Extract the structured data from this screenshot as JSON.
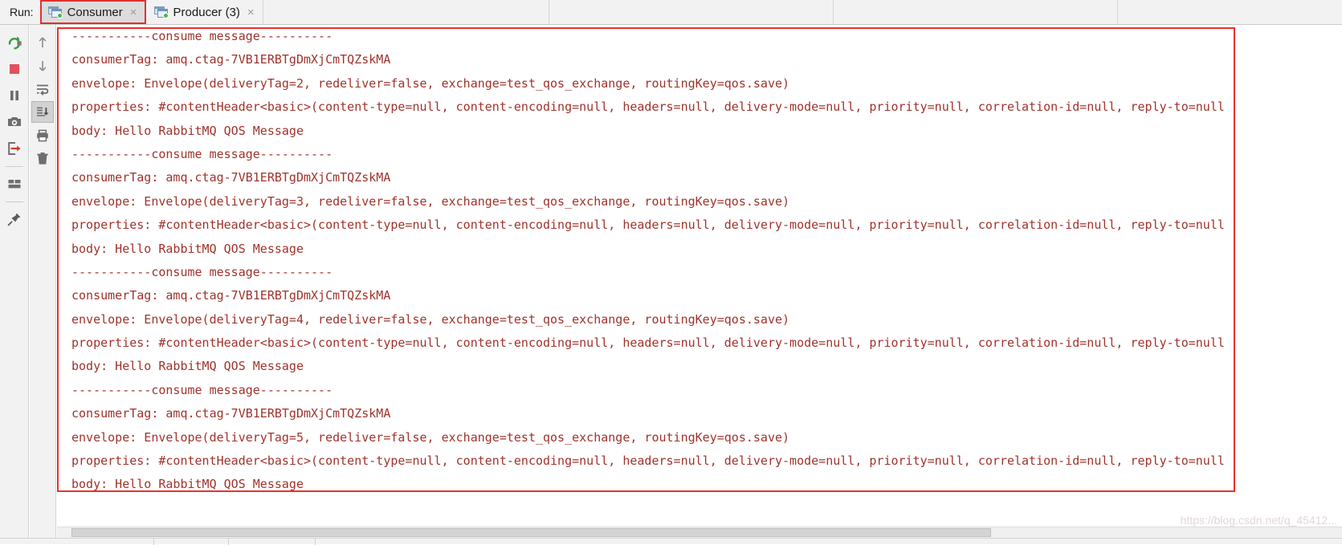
{
  "window": {
    "run_label": "Run:",
    "tabs": [
      {
        "label": "Consumer",
        "icon": "run-window-icon",
        "close": "×",
        "active": true,
        "highlighted": true
      },
      {
        "label": "Producer (3)",
        "icon": "run-window-icon",
        "close": "×",
        "active": false,
        "highlighted": false
      }
    ]
  },
  "toolbar_left": {
    "items": [
      {
        "name": "rerun-button",
        "title": "Rerun"
      },
      {
        "name": "stop-button",
        "title": "Stop"
      },
      {
        "name": "pause-button",
        "title": "Pause Output"
      },
      {
        "name": "camera-button",
        "title": "Dump Threads"
      },
      {
        "name": "export-button",
        "title": "Export to Text File"
      },
      {
        "name": "layout-button",
        "title": "Layout"
      },
      {
        "name": "pin-button",
        "title": "Pin Tab"
      }
    ]
  },
  "toolbar_console": {
    "items": [
      {
        "name": "up-arrow-button",
        "title": "Up the Stack Trace"
      },
      {
        "name": "down-arrow-button",
        "title": "Down the Stack Trace"
      },
      {
        "name": "soft-wrap-button",
        "title": "Use Soft Wraps"
      },
      {
        "name": "scroll-to-end-button",
        "title": "Scroll to the End",
        "toggled": true
      },
      {
        "name": "print-button",
        "title": "Print"
      },
      {
        "name": "clear-all-button",
        "title": "Clear All"
      }
    ]
  },
  "console": {
    "text_color": "#a0332c",
    "background": "#ffffff",
    "separator": "-----------consume message----------",
    "lines": [
      "-----------consume message----------",
      "consumerTag: amq.ctag-7VB1ERBTgDmXjCmTQZskMA",
      "envelope: Envelope(deliveryTag=2, redeliver=false, exchange=test_qos_exchange, routingKey=qos.save)",
      "properties: #contentHeader<basic>(content-type=null, content-encoding=null, headers=null, delivery-mode=null, priority=null, correlation-id=null, reply-to=null",
      "body: Hello RabbitMQ QOS Message",
      "-----------consume message----------",
      "consumerTag: amq.ctag-7VB1ERBTgDmXjCmTQZskMA",
      "envelope: Envelope(deliveryTag=3, redeliver=false, exchange=test_qos_exchange, routingKey=qos.save)",
      "properties: #contentHeader<basic>(content-type=null, content-encoding=null, headers=null, delivery-mode=null, priority=null, correlation-id=null, reply-to=null",
      "body: Hello RabbitMQ QOS Message",
      "-----------consume message----------",
      "consumerTag: amq.ctag-7VB1ERBTgDmXjCmTQZskMA",
      "envelope: Envelope(deliveryTag=4, redeliver=false, exchange=test_qos_exchange, routingKey=qos.save)",
      "properties: #contentHeader<basic>(content-type=null, content-encoding=null, headers=null, delivery-mode=null, priority=null, correlation-id=null, reply-to=null",
      "body: Hello RabbitMQ QOS Message",
      "-----------consume message----------",
      "consumerTag: amq.ctag-7VB1ERBTgDmXjCmTQZskMA",
      "envelope: Envelope(deliveryTag=5, redeliver=false, exchange=test_qos_exchange, routingKey=qos.save)",
      "properties: #contentHeader<basic>(content-type=null, content-encoding=null, headers=null, delivery-mode=null, priority=null, correlation-id=null, reply-to=null",
      "body: Hello RabbitMQ QOS Message"
    ]
  },
  "annotation": {
    "box_color": "#e8312a"
  },
  "watermark": {
    "text": "https://blog.csdn.net/q_45412..."
  },
  "scrollbar": {
    "name": "horizontal-scrollbar"
  }
}
